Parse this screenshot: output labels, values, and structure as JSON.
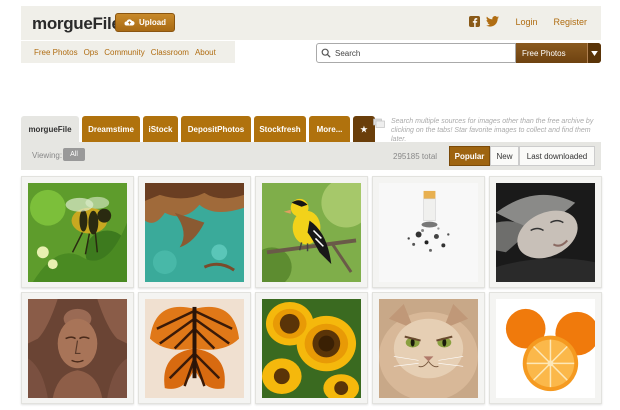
{
  "header": {
    "logo": "morgueFile",
    "upload_label": "Upload",
    "login_label": "Login",
    "register_label": "Register"
  },
  "nav": {
    "items": [
      "Free Photos",
      "Ops",
      "Community",
      "Classroom",
      "About"
    ]
  },
  "search": {
    "placeholder": "Search",
    "scope": "Free Photos"
  },
  "tabs": {
    "items": [
      "morgueFile",
      "Dreamstime",
      "iStock",
      "DepositPhotos",
      "Stockfresh",
      "More...",
      "★"
    ],
    "active": "morgueFile",
    "hint": "Search multiple sources for images other than the free archive by clicking on the tabs! Star favorite images to collect and find them later."
  },
  "toolbar": {
    "viewing_label": "Viewing:",
    "viewing_value": "All",
    "total": "295185 total",
    "sort": [
      "Popular",
      "New",
      "Last downloaded"
    ],
    "sort_active": "Popular"
  },
  "colors": {
    "accent": "#b0720d",
    "accent_dark": "#6a3e0a",
    "header_bg": "#f0efe9",
    "toolbar_bg": "#e6e6e2",
    "link": "#b06d12"
  },
  "icons": [
    "cloud-upload-icon",
    "facebook-icon",
    "twitter-icon",
    "search-icon",
    "chevron-down-icon",
    "star-icon",
    "info-icon"
  ]
}
